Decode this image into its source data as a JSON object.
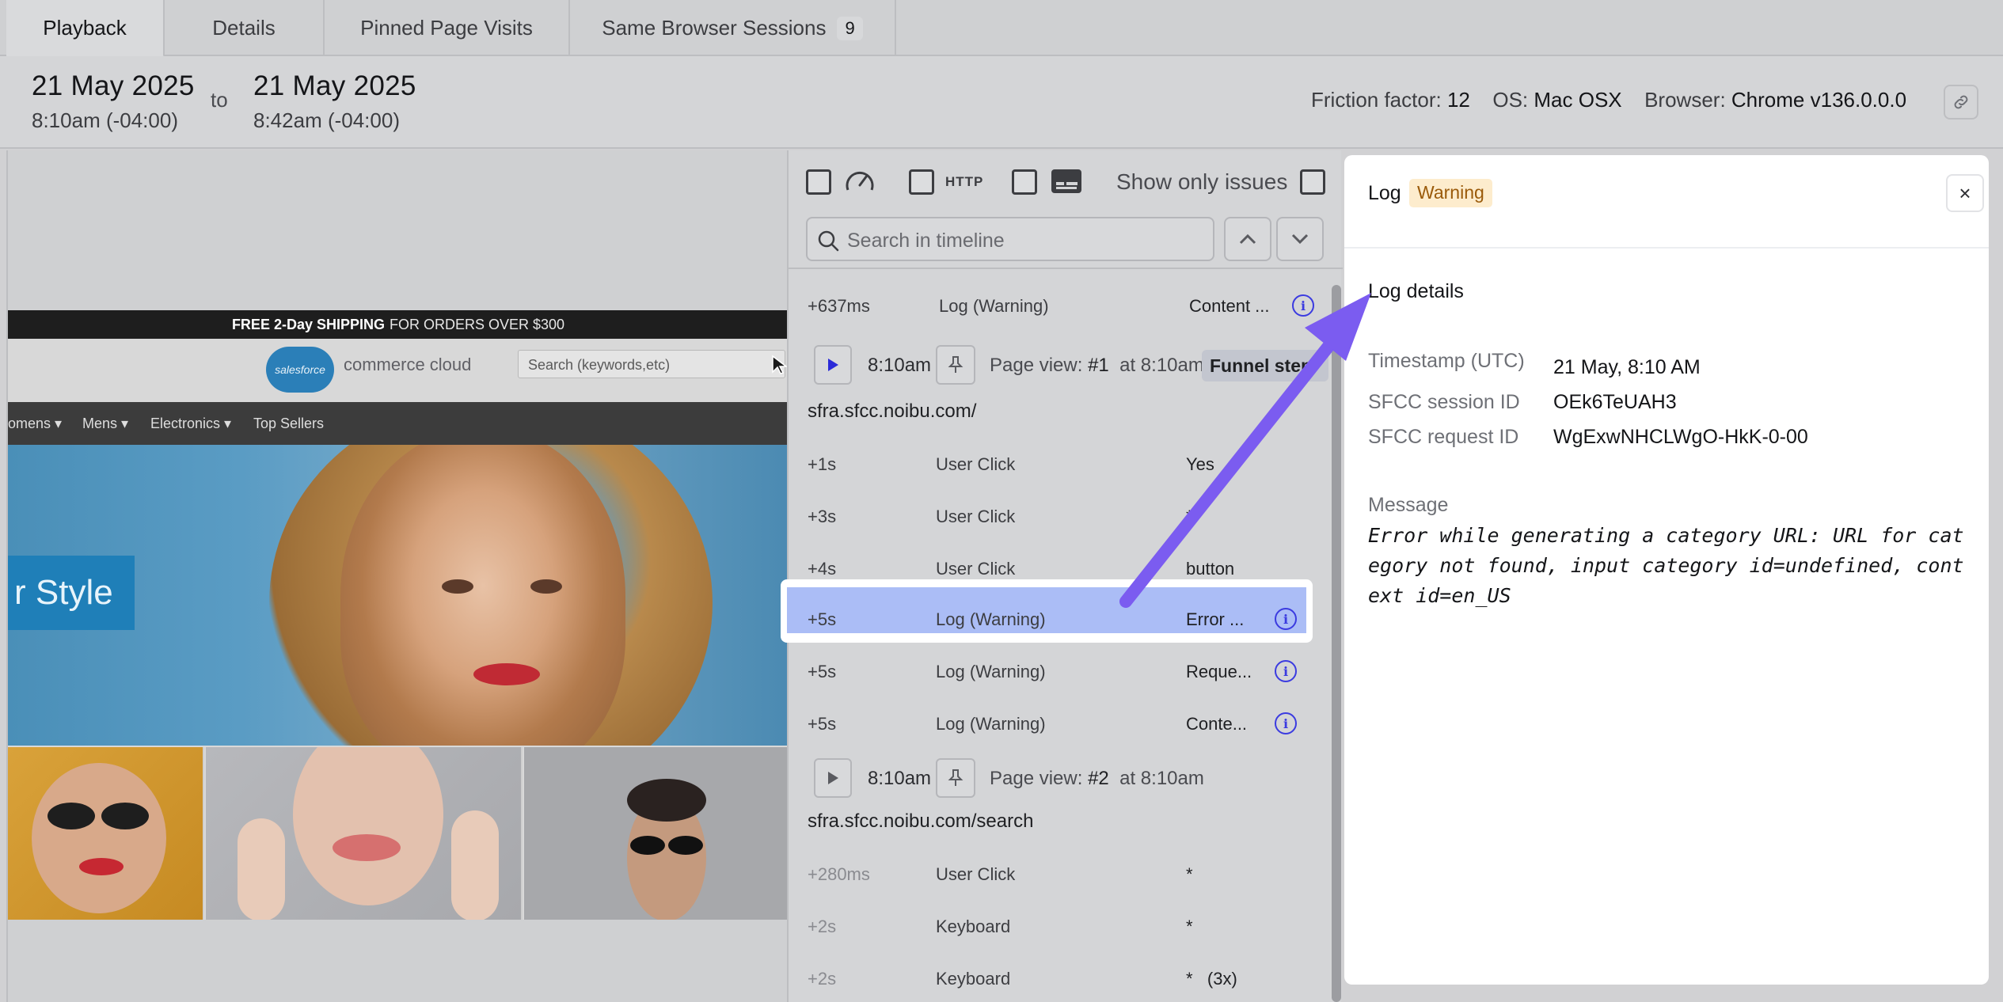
{
  "tabs": [
    {
      "label": "Playback",
      "active": true
    },
    {
      "label": "Details"
    },
    {
      "label": "Pinned Page Visits"
    },
    {
      "label": "Same Browser Sessions",
      "count": "9"
    }
  ],
  "header": {
    "start_date": "21 May 2025",
    "start_time": "8:10am (-04:00)",
    "to_label": "to",
    "end_date": "21 May 2025",
    "end_time": "8:42am (-04:00)",
    "friction_label": "Friction factor:",
    "friction_value": "12",
    "os_label": "OS:",
    "os_value": "Mac OSX",
    "browser_label": "Browser:",
    "browser_value": "Chrome v136.0.0.0"
  },
  "site": {
    "shipping_bold": "FREE 2-Day SHIPPING",
    "shipping_rest": "FOR ORDERS OVER $300",
    "logo_text": "salesforce",
    "brand_text": "commerce cloud",
    "search_placeholder": "Search (keywords,etc)",
    "nav": [
      "omens ▾",
      "Mens ▾",
      "Electronics ▾",
      "Top Sellers"
    ],
    "hero_tag": "r Style"
  },
  "timeline": {
    "http_label": "HTTP",
    "show_only_issues": "Show only issues",
    "search_placeholder": "Search in timeline",
    "top_row": {
      "time": "+637ms",
      "type": "Log (Warning)",
      "value": "Content ..."
    },
    "page_view_1": {
      "time": "8:10am",
      "label": "Page view:",
      "num": "#1",
      "at": "at 8:10am",
      "funnel": "Funnel step",
      "url": "sfra.sfcc.noibu.com/"
    },
    "rows_1": [
      {
        "time": "+1s",
        "type": "User Click",
        "value": "Yes"
      },
      {
        "time": "+3s",
        "type": "User Click",
        "value": "*"
      },
      {
        "time": "+4s",
        "type": "User Click",
        "value": "button"
      },
      {
        "time": "+5s",
        "type": "Log (Warning)",
        "value": "Error ..."
      },
      {
        "time": "+5s",
        "type": "Log (Warning)",
        "value": "Reque..."
      },
      {
        "time": "+5s",
        "type": "Log (Warning)",
        "value": "Conte..."
      }
    ],
    "page_view_2": {
      "time": "8:10am",
      "label": "Page view:",
      "num": "#2",
      "at": "at 8:10am",
      "url": "sfra.sfcc.noibu.com/search"
    },
    "rows_2": [
      {
        "time": "+280ms",
        "type": "User Click",
        "value": "*"
      },
      {
        "time": "+2s",
        "type": "Keyboard",
        "value": "*"
      },
      {
        "time": "+2s",
        "type": "Keyboard",
        "value": "*   (3x)"
      }
    ],
    "info_glyph": "i"
  },
  "detail": {
    "title": "Log",
    "badge": "Warning",
    "close_glyph": "×",
    "section": "Log details",
    "fields": [
      {
        "key": "Timestamp (UTC)",
        "value": "21 May, 8:10 AM"
      },
      {
        "key": "SFCC session ID",
        "value": "OEk6TeUAH3"
      },
      {
        "key": "SFCC request ID",
        "value": "WgExwNHCLWgO-HkK-0-00"
      }
    ],
    "message_label": "Message",
    "message": "Error while generating a category URL: URL for category not found, input category id=undefined, context id=en_US"
  },
  "colors": {
    "accent": "#7b5cf0",
    "info": "#3b3be0",
    "highlight_row": "#abbdf6",
    "warning_bg": "#fdeccd",
    "warning_text": "#9a5a0a"
  },
  "icons": [
    "speedometer-icon",
    "subtitles-icon",
    "search-icon",
    "chevron-up-icon",
    "chevron-down-icon",
    "play-icon",
    "pin-icon",
    "info-icon",
    "link-icon",
    "close-icon"
  ]
}
